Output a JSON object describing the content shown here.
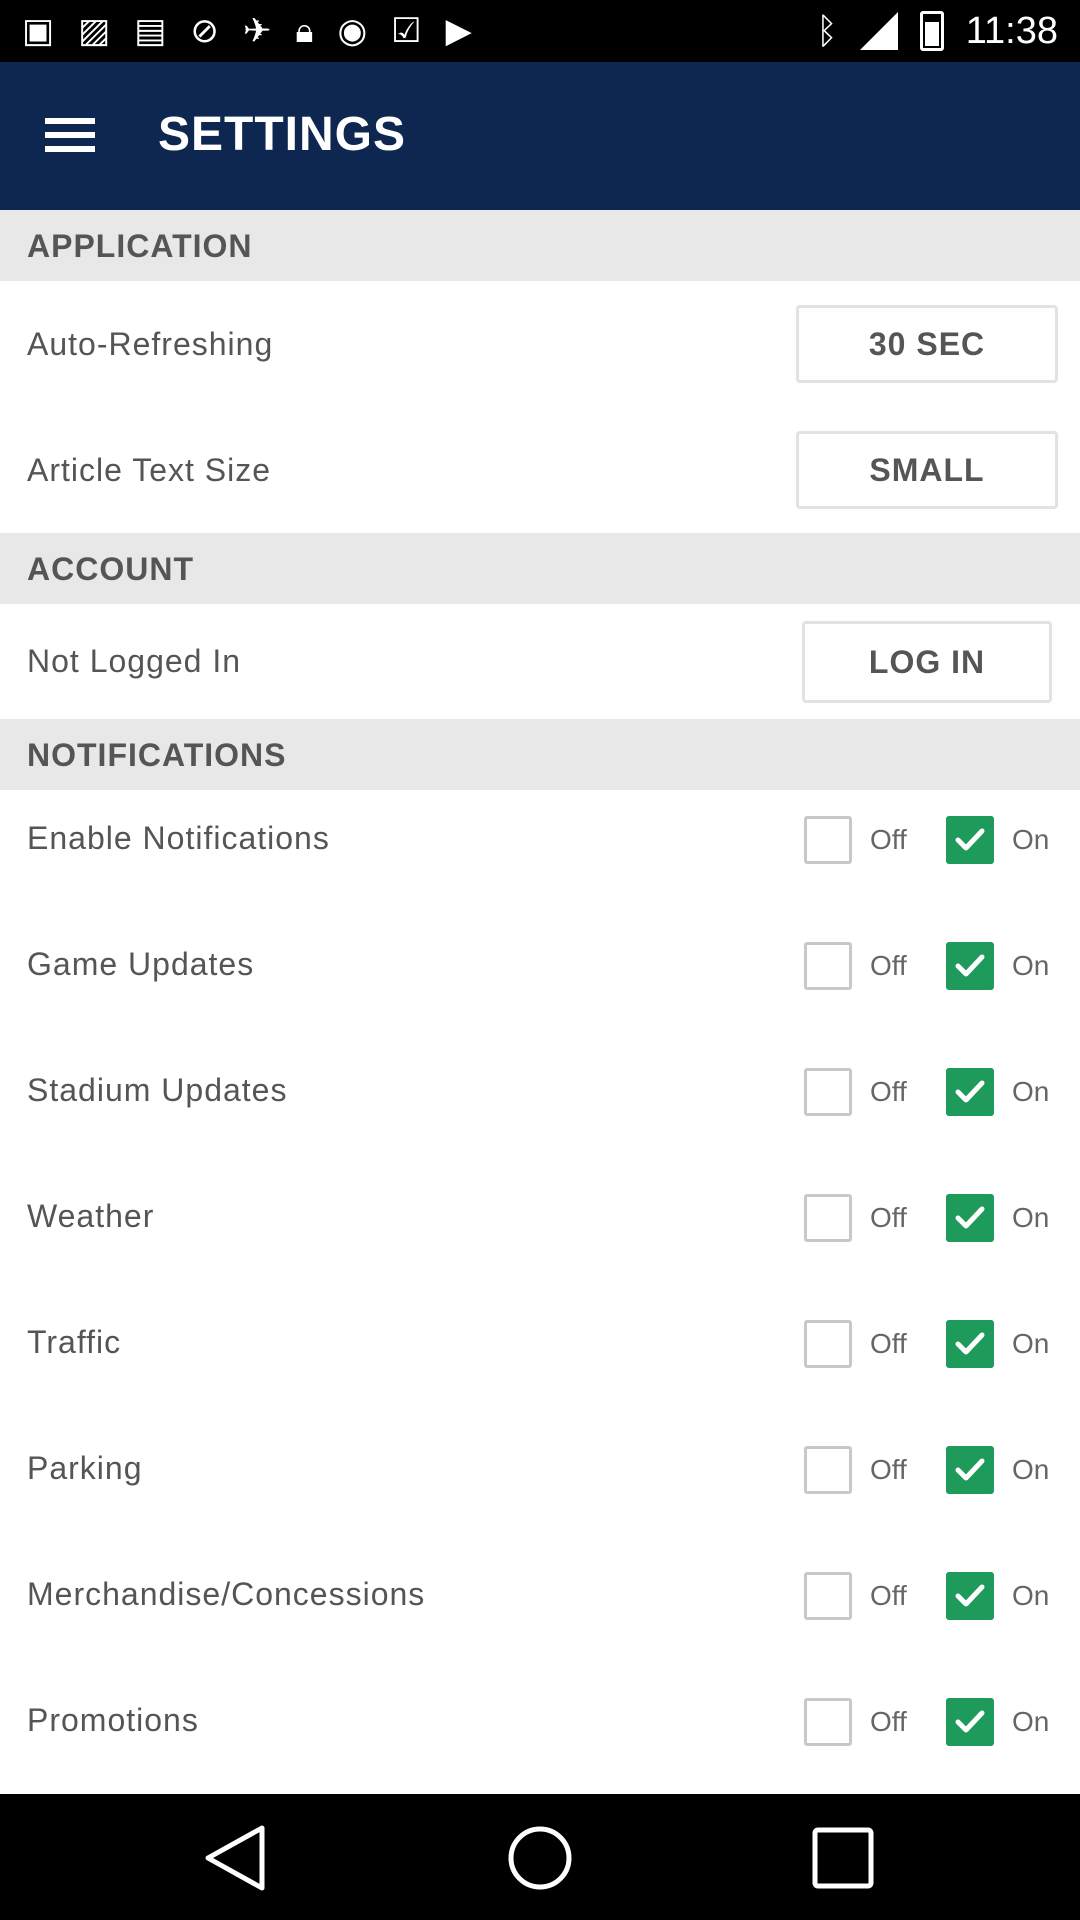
{
  "status_bar": {
    "time": "11:38",
    "left_icons": [
      "app-icon",
      "photo-icon",
      "message-icon",
      "disabled-icon",
      "satellite-icon",
      "lock-icon",
      "face-icon",
      "check-icon",
      "bag-icon"
    ],
    "right_icons": [
      "bluetooth-icon",
      "signal-icon",
      "battery-icon"
    ]
  },
  "app_bar": {
    "title": "SETTINGS",
    "background": "#0e2751"
  },
  "sections": {
    "application": {
      "header": "APPLICATION",
      "auto_refreshing": {
        "label": "Auto-Refreshing",
        "value": "30 SEC"
      },
      "article_text_size": {
        "label": "Article Text Size",
        "value": "SMALL"
      }
    },
    "account": {
      "header": "ACCOUNT",
      "status_label": "Not Logged In",
      "login_button": "LOG IN"
    },
    "notifications": {
      "header": "NOTIFICATIONS",
      "off_label": "Off",
      "on_label": "On",
      "items": [
        {
          "label": "Enable Notifications",
          "on": true
        },
        {
          "label": "Game Updates",
          "on": true
        },
        {
          "label": "Stadium Updates",
          "on": true
        },
        {
          "label": "Weather",
          "on": true
        },
        {
          "label": "Traffic",
          "on": true
        },
        {
          "label": "Parking",
          "on": true
        },
        {
          "label": "Merchandise/Concessions",
          "on": true
        },
        {
          "label": "Promotions",
          "on": true
        }
      ]
    }
  },
  "colors": {
    "accent": "#1e9a5b",
    "section_bg": "#e8e8e8"
  },
  "nav_bar": {
    "buttons": [
      "back-icon",
      "home-icon",
      "recents-icon"
    ]
  }
}
